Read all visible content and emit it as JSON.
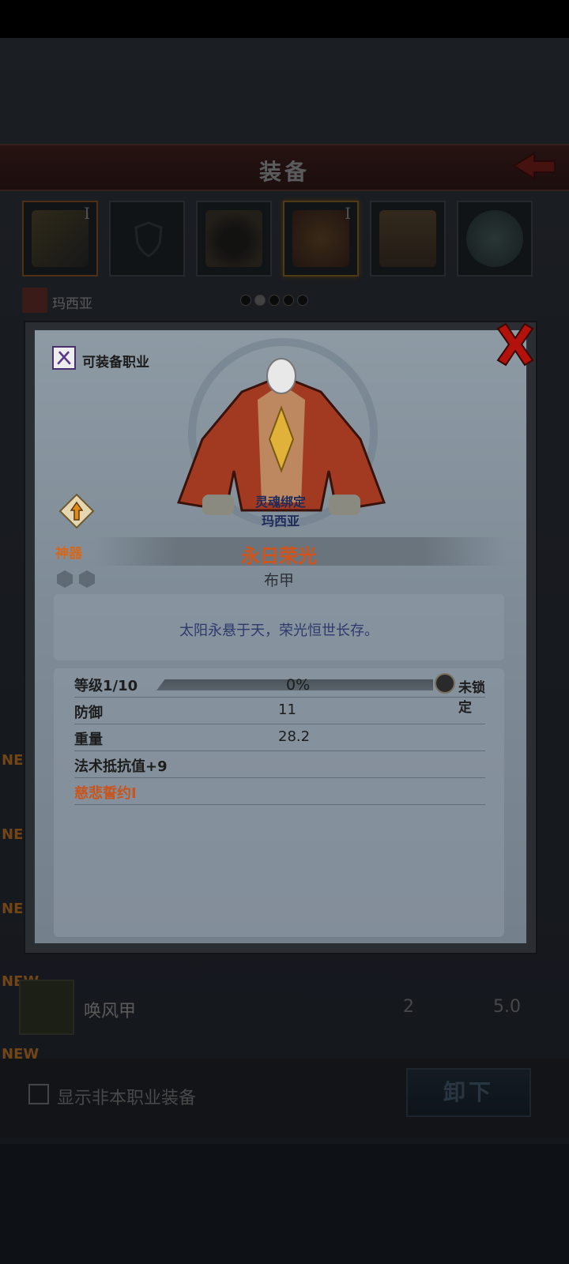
{
  "background": {
    "header_title": "装备",
    "character_name": "玛西亚",
    "slots": [
      {
        "name": "weapon",
        "tier": "I"
      },
      {
        "name": "offhand",
        "tier": ""
      },
      {
        "name": "helmet",
        "tier": ""
      },
      {
        "name": "armor",
        "tier": "I"
      },
      {
        "name": "boots",
        "tier": ""
      },
      {
        "name": "amulet",
        "tier": ""
      }
    ],
    "new_tag": "NEW",
    "list_item": {
      "name": "唤风甲",
      "value1": "2",
      "value2": "5.0"
    },
    "show_other_classes_label": "显示非本职业装备",
    "unequip_label": "卸下"
  },
  "modal": {
    "class_label": "可装备职业",
    "soulbound_label": "灵魂绑定",
    "soulbound_owner": "玛西亚",
    "artifact_label": "神器",
    "item_name": "永日荣光",
    "item_type": "布甲",
    "description": "太阳永悬于天，荣光恒世长存。",
    "level_label": "等级1/10",
    "level_percent": "0%",
    "level_progress": 0,
    "lock_label": "未锁定",
    "stats": [
      {
        "label": "防御",
        "value": "11"
      },
      {
        "label": "重量",
        "value": "28.2"
      }
    ],
    "resist_label": "法术抵抗值+9",
    "skill_label": "慈悲誓约I"
  },
  "colors": {
    "item_name": "#d2541a",
    "artifact": "#d2691e",
    "description": "#2d3a6c"
  }
}
